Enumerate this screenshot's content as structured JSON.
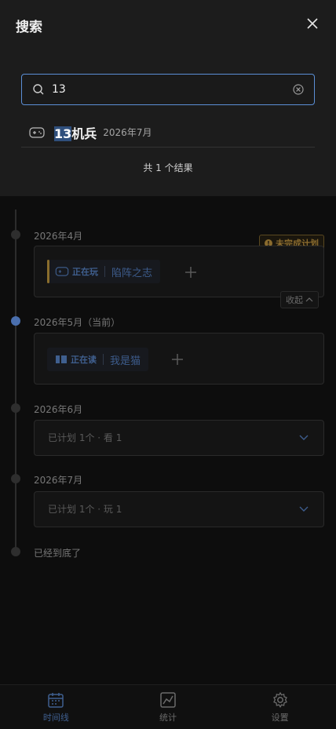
{
  "search": {
    "title": "搜索",
    "query": "13",
    "result": {
      "highlight": "13",
      "rest": "机兵",
      "date": "2026年7月"
    },
    "result_count": "共 1 个结果"
  },
  "timeline": {
    "months": [
      {
        "label": "2026年4月",
        "badge": "未完成计划",
        "item": {
          "status": "正在玩",
          "title": "陷阵之志"
        },
        "collapse_label": "收起"
      },
      {
        "label": "2026年5月（当前）",
        "item": {
          "status": "正在读",
          "title": "我是猫"
        }
      },
      {
        "label": "2026年6月",
        "summary": "已计划 1个 · 看 1"
      },
      {
        "label": "2026年7月",
        "summary": "已计划 1个 · 玩 1"
      }
    ],
    "end_text": "已经到底了"
  },
  "nav": {
    "items": [
      {
        "label": "时间线",
        "icon": "calendar-icon",
        "active": true
      },
      {
        "label": "统计",
        "icon": "chart-icon",
        "active": false
      },
      {
        "label": "设置",
        "icon": "gear-icon",
        "active": false
      }
    ]
  },
  "colors": {
    "accent": "#5b8fd6",
    "warning": "#8a6b2e"
  }
}
